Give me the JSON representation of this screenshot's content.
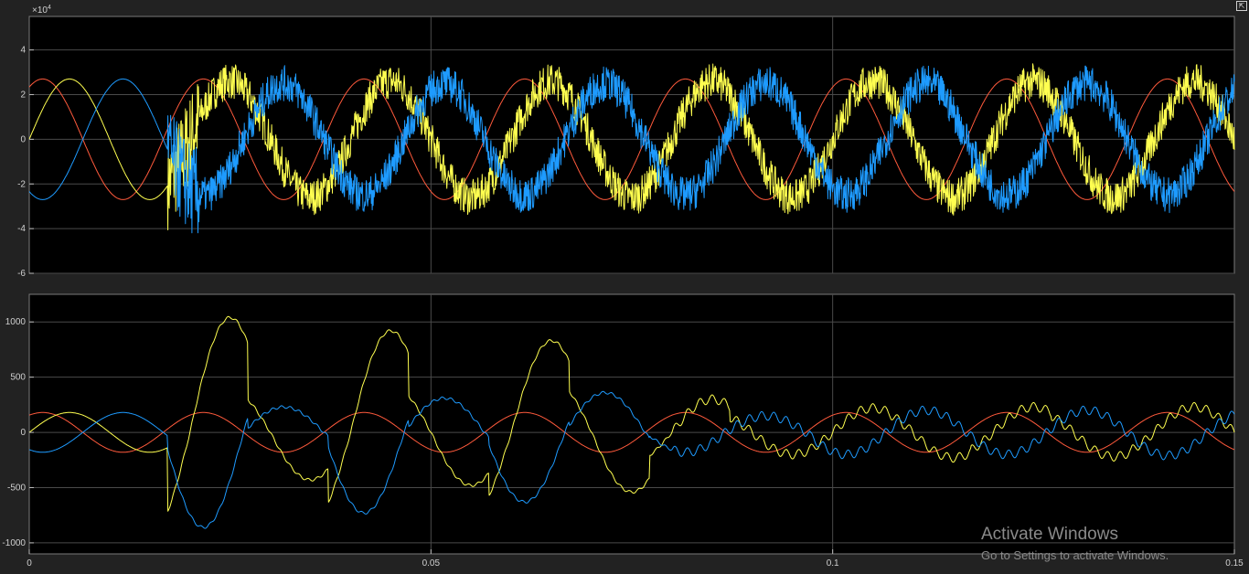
{
  "chart_data": [
    {
      "type": "line",
      "panel": "top",
      "exponent_label_base": "×10",
      "exponent_label_power": "4",
      "xlim": [
        0,
        0.15
      ],
      "ylim": [
        -6,
        5.5
      ],
      "yticks": [
        {
          "value": 4,
          "label": "4"
        },
        {
          "value": 2,
          "label": "2"
        },
        {
          "value": 0,
          "label": "0"
        },
        {
          "value": -2,
          "label": "-2"
        },
        {
          "value": -4,
          "label": "-4"
        },
        {
          "value": -6,
          "label": "-6"
        }
      ],
      "xgrid": [
        0.05,
        0.1
      ],
      "grid": true,
      "series": [
        {
          "color": "#ff5a3c",
          "frequency_hz": 50,
          "amplitude": 2.7,
          "phase_deg": 60,
          "noise": false
        },
        {
          "color": "#ffff50",
          "frequency_hz": 50,
          "amplitude": 2.7,
          "phase_deg": 0,
          "t_onset": 0.0172,
          "amplitude_after": 2.6,
          "noise": true
        },
        {
          "color": "#1e9bff",
          "frequency_hz": 50,
          "amplitude": 2.7,
          "phase_deg": -120,
          "t_onset": 0.0172,
          "amplitude_after": 2.5,
          "noise": true
        }
      ]
    },
    {
      "type": "line",
      "panel": "bottom",
      "xlim": [
        0,
        0.15
      ],
      "ylim": [
        -1100,
        1250
      ],
      "yticks": [
        {
          "value": 1000,
          "label": "1000"
        },
        {
          "value": 500,
          "label": "500"
        },
        {
          "value": 0,
          "label": "0"
        },
        {
          "value": -500,
          "label": "-500"
        },
        {
          "value": -1000,
          "label": "-1000"
        }
      ],
      "xticks": [
        {
          "value": 0,
          "label": "0"
        },
        {
          "value": 0.05,
          "label": "0.05"
        },
        {
          "value": 0.1,
          "label": "0.1"
        },
        {
          "value": 0.15,
          "label": "0.15"
        }
      ],
      "grid": true,
      "series": [
        {
          "color": "#ff5a3c",
          "frequency_hz": 50,
          "amplitude": 180,
          "phase_deg": 60
        },
        {
          "color": "#ffff50",
          "frequency_hz": 50,
          "amplitude": 180,
          "phase_deg": 0,
          "t_onset": 0.0172,
          "peaks_after": [
            1040,
            -430,
            920,
            -480,
            830,
            -540,
            300,
            -200,
            220,
            -230,
            230,
            -220,
            230
          ]
        },
        {
          "color": "#1e9bff",
          "frequency_hz": 50,
          "amplitude": 180,
          "phase_deg": -120,
          "t_onset": 0.0172,
          "peaks_after": [
            -860,
            230,
            -730,
            310,
            -630,
            360,
            -180,
            150,
            -200,
            200,
            -200,
            200,
            -210
          ]
        }
      ]
    }
  ],
  "watermark": {
    "title": "Activate Windows",
    "subtitle": "Go to Settings to activate Windows."
  },
  "icons": {
    "undock": "undock-icon"
  }
}
